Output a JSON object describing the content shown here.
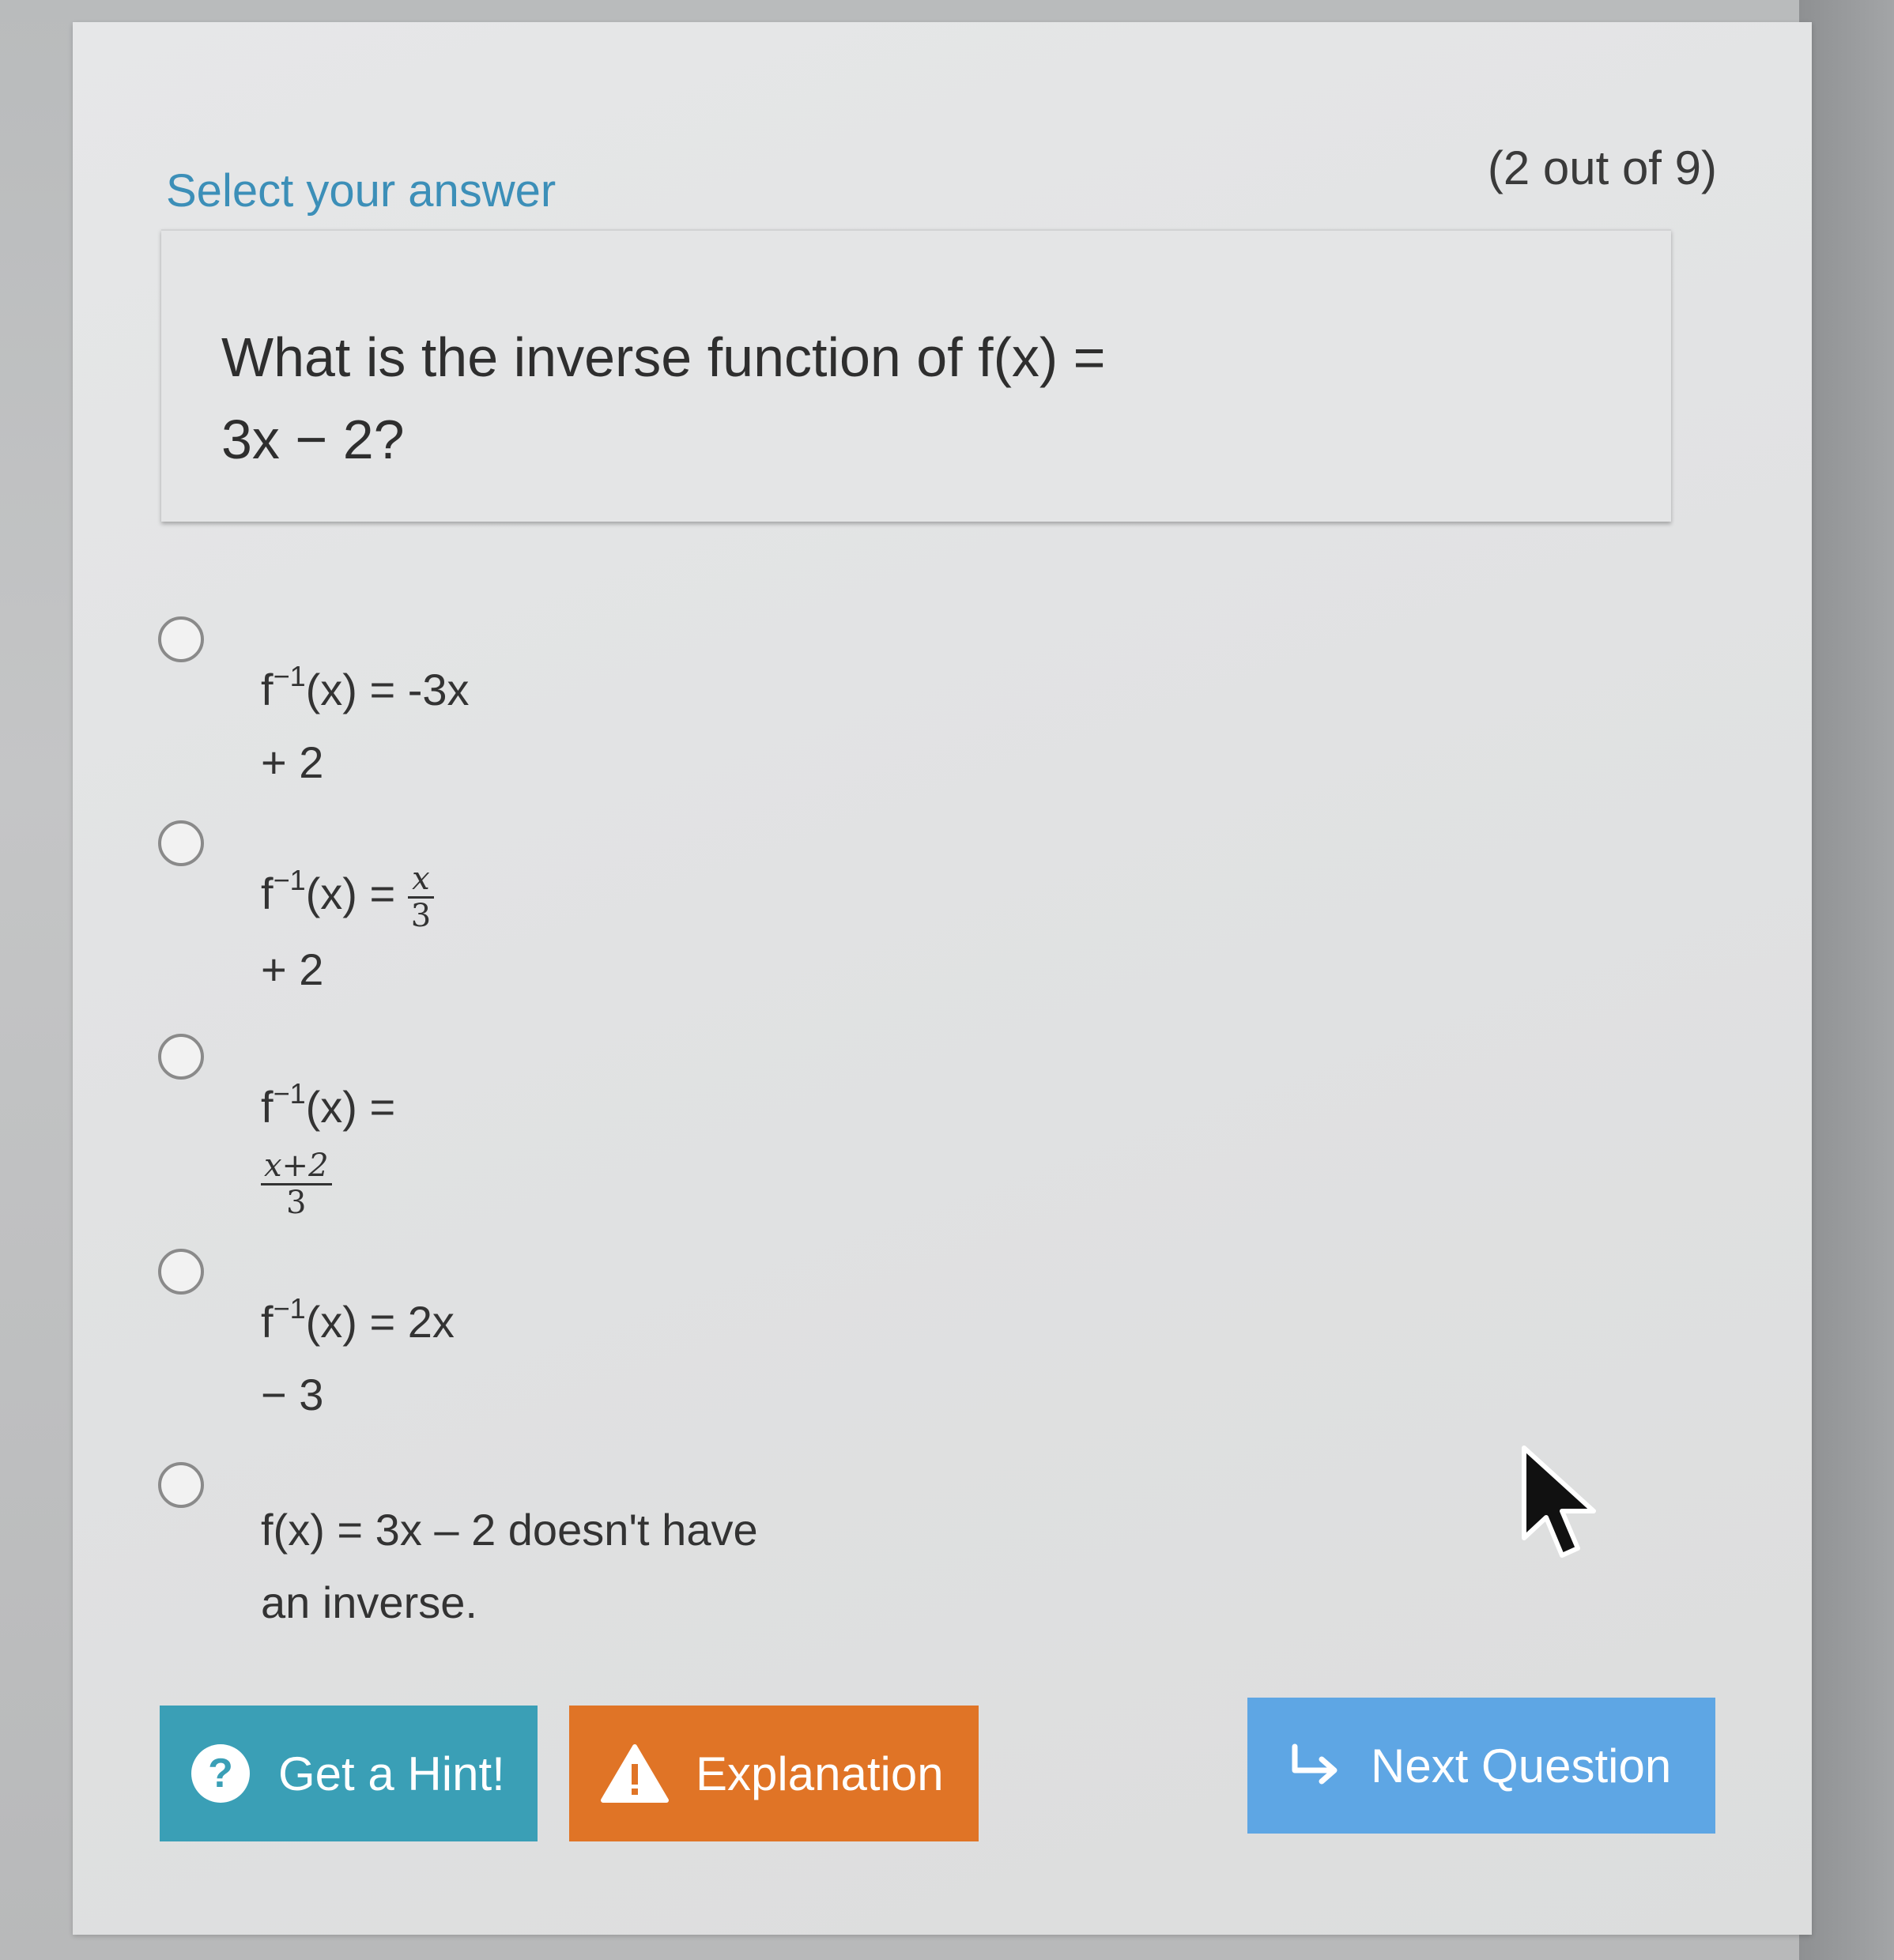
{
  "header": {
    "title": "Select your answer",
    "progress": "(2 out of 9)"
  },
  "question": {
    "line1": "What is the inverse function of f(x) =",
    "line2": "3x − 2?"
  },
  "options": [
    {
      "prefix": "f",
      "sup": "−1",
      "mid": "(x) = -3x",
      "line2": "+ 2"
    },
    {
      "prefix": "f",
      "sup": "−1",
      "mid": "(x) =",
      "frac_num": "x",
      "frac_den": "3",
      "line2": "+ 2"
    },
    {
      "prefix": "f",
      "sup": "−1",
      "mid": "(x) =",
      "frac_num": "x+2",
      "frac_den": "3"
    },
    {
      "prefix": "f",
      "sup": "−1",
      "mid": "(x) = 2x",
      "line2": "− 3"
    },
    {
      "line1": "f(x) = 3x – 2 doesn't have",
      "line2": "an inverse."
    }
  ],
  "buttons": {
    "hint": "Get a Hint!",
    "hint_icon": "?",
    "explanation": "Explanation",
    "next": "Next Question"
  },
  "colors": {
    "title": "#3c8fb8",
    "hint_button": "#3a9fb6",
    "explanation_button": "#e07426",
    "next_button": "#5ea6e4"
  },
  "icons": {
    "hint": "question-circle-icon",
    "explanation": "warning-triangle-icon",
    "next": "arrow-return-right-icon",
    "cursor": "mouse-pointer-icon"
  }
}
